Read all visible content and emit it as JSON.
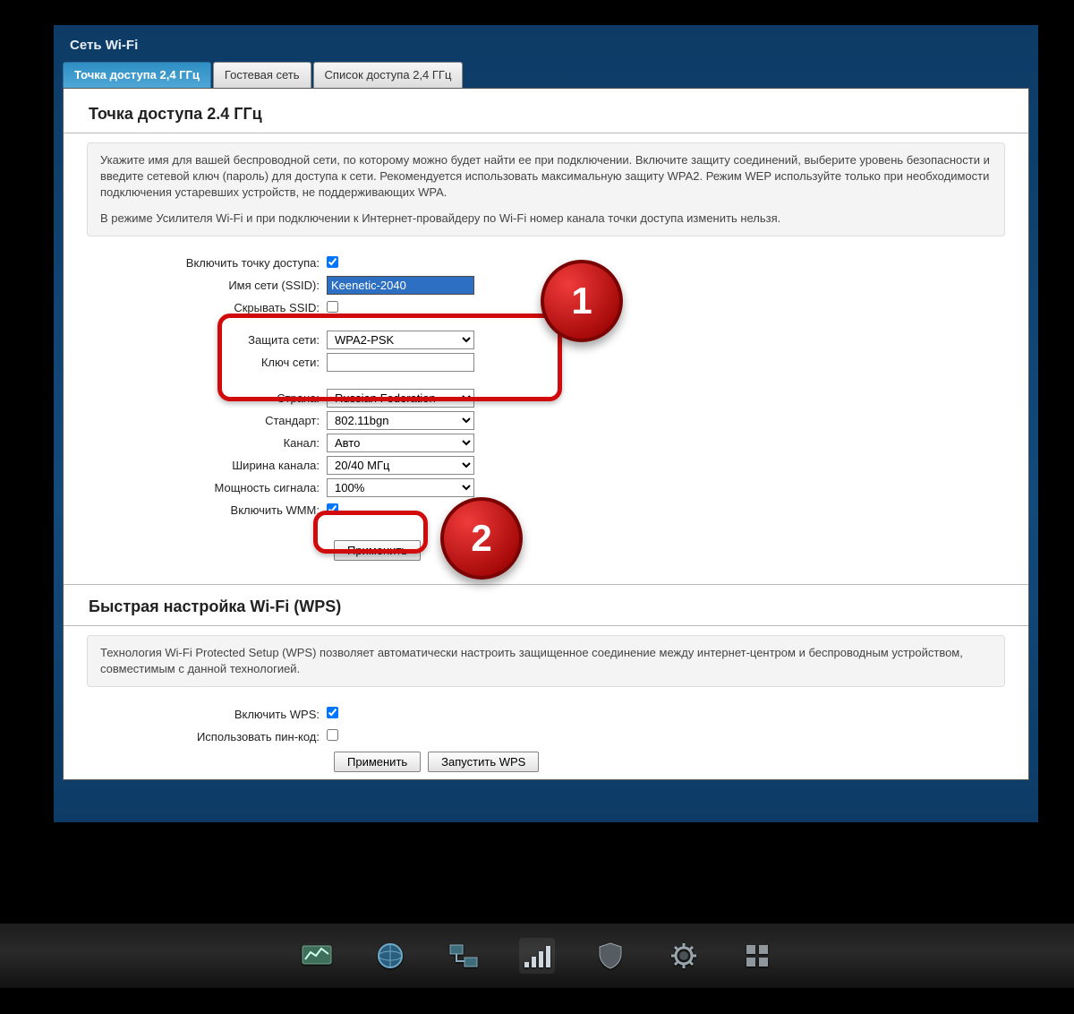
{
  "header": {
    "title": "Сеть Wi-Fi"
  },
  "tabs": [
    {
      "label": "Точка доступа 2,4 ГГц",
      "active": true
    },
    {
      "label": "Гостевая сеть",
      "active": false
    },
    {
      "label": "Список доступа 2,4 ГГц",
      "active": false
    }
  ],
  "ap": {
    "heading": "Точка доступа 2.4 ГГц",
    "info_p1": "Укажите имя для вашей беспроводной сети, по которому можно будет найти ее при подключении. Включите защиту соединений, выберите уровень безопасности и введите сетевой ключ (пароль) для доступа к сети. Рекомендуется использовать максимальную защиту WPA2. Режим WEP используйте только при необходимости подключения устаревших устройств, не поддерживающих WPA.",
    "info_p2": "В режиме Усилителя Wi-Fi и при подключении к Интернет-провайдеру по Wi-Fi номер канала точки доступа изменить нельзя.",
    "labels": {
      "enable_ap": "Включить точку доступа:",
      "ssid": "Имя сети (SSID):",
      "hide_ssid": "Скрывать SSID:",
      "security": "Защита сети:",
      "key": "Ключ сети:",
      "country": "Страна:",
      "standard": "Стандарт:",
      "channel": "Канал:",
      "width": "Ширина канала:",
      "power": "Мощность сигнала:",
      "wmm": "Включить WMM:"
    },
    "values": {
      "enable_ap": true,
      "ssid": "Keenetic-2040",
      "hide_ssid": false,
      "security": "WPA2-PSK",
      "key": "",
      "country": "Russian Federation",
      "standard": "802.11bgn",
      "channel": "Авто",
      "width": "20/40 МГц",
      "power": "100%",
      "wmm": true
    },
    "apply_label": "Применить"
  },
  "wps": {
    "heading": "Быстрая настройка Wi-Fi (WPS)",
    "info": "Технология Wi-Fi Protected Setup (WPS) позволяет автоматически настроить защищенное соединение между интернет-центром и беспроводным устройством, совместимым с данной технологией.",
    "labels": {
      "enable_wps": "Включить WPS:",
      "use_pin": "Использовать пин-код:"
    },
    "values": {
      "enable_wps": true,
      "use_pin": false
    },
    "apply_label": "Применить",
    "start_label": "Запустить WPS"
  },
  "callouts": {
    "badge1": "1",
    "badge2": "2"
  },
  "dock": {
    "items": [
      {
        "name": "monitor-icon"
      },
      {
        "name": "globe-icon"
      },
      {
        "name": "network-icon"
      },
      {
        "name": "wifi-bars-icon",
        "active": true
      },
      {
        "name": "shield-icon"
      },
      {
        "name": "gear-icon"
      },
      {
        "name": "apps-icon"
      }
    ]
  }
}
